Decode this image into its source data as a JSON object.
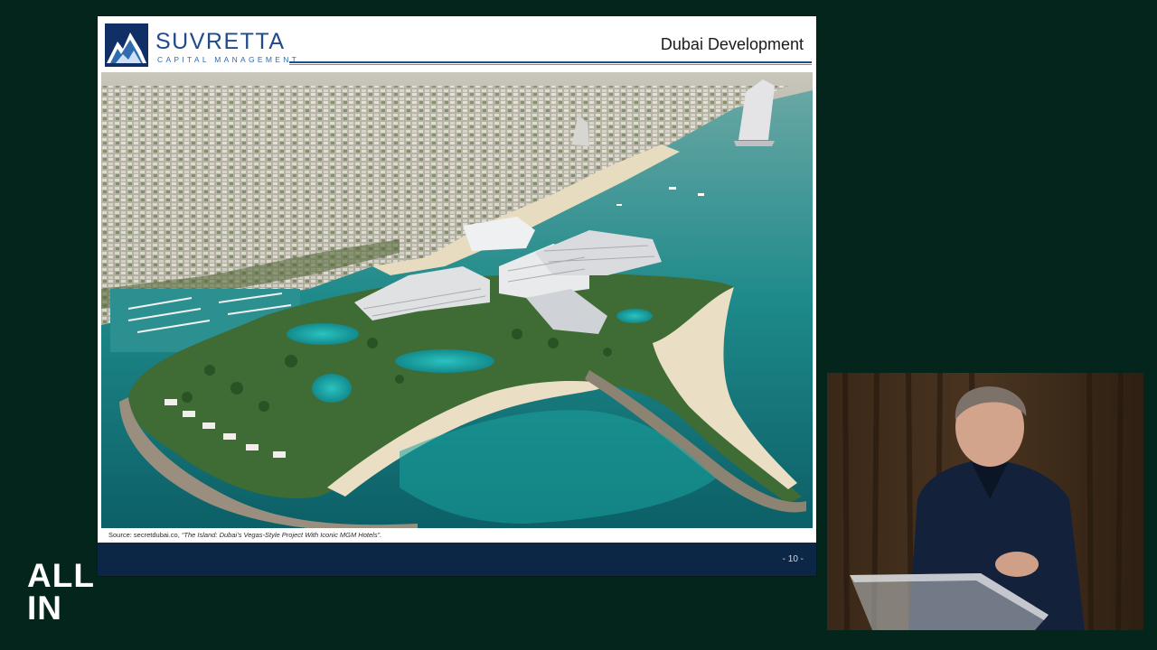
{
  "slide": {
    "logo": {
      "name": "SUVRETTA",
      "subtitle": "CAPITAL MANAGEMENT",
      "icon": "mountain-logo-icon"
    },
    "title": "Dubai Development",
    "image_subject": "aerial-resort-island-render",
    "source": {
      "prefix": "Source: secretdubai.co, ",
      "citation": "“The Island: Dubai’s Vegas-Style Project With Iconic MGM Hotels”."
    },
    "page_number": "- 10 -"
  },
  "brand": {
    "line1": "ALL",
    "line2": "IN"
  },
  "video": {
    "subject": "presenter-at-podium"
  },
  "colors": {
    "background": "#04251b",
    "slide_header_blue": "#1f4b8c",
    "slide_footer": "#0c2746",
    "sea": "#1c8c8a"
  }
}
